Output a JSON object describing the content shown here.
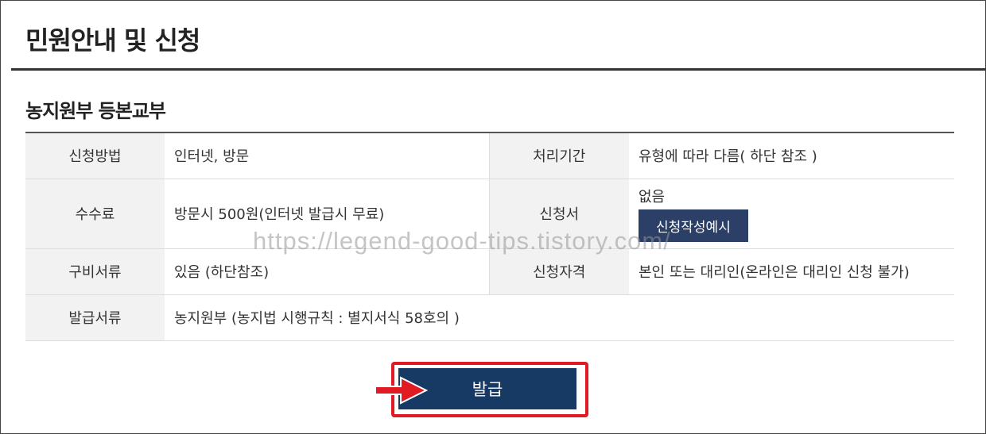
{
  "page": {
    "title": "민원안내 및 신청"
  },
  "section": {
    "title": "농지원부 등본교부"
  },
  "info": {
    "apply_method": {
      "label": "신청방법",
      "value": "인터넷, 방문"
    },
    "processing_period": {
      "label": "처리기간",
      "value": "유형에 따라 다름( 하단 참조 )"
    },
    "fee": {
      "label": "수수료",
      "value": "방문시 500원(인터넷 발급시 무료)"
    },
    "application_form": {
      "label": "신청서",
      "value": "없음",
      "example_button": "신청작성예시"
    },
    "required_docs": {
      "label": "구비서류",
      "value": "있음 (하단참조)"
    },
    "eligibility": {
      "label": "신청자격",
      "value": "본인 또는 대리인(온라인은 대리인 신청 불가)"
    },
    "issued_docs": {
      "label": "발급서류",
      "value": "농지원부 (농지법 시행규칙 : 별지서식 58호의 )"
    }
  },
  "actions": {
    "issue_label": "발급"
  },
  "overlay": {
    "watermark": "https://legend-good-tips.tistory.com/"
  },
  "colors": {
    "header_cell_bg": "#f2f2f2",
    "issue_button_bg": "#163a63",
    "example_button_bg": "#2b3f67",
    "highlight_red": "#e01b24"
  },
  "icons": {
    "pointer": "red-arrow-icon"
  }
}
